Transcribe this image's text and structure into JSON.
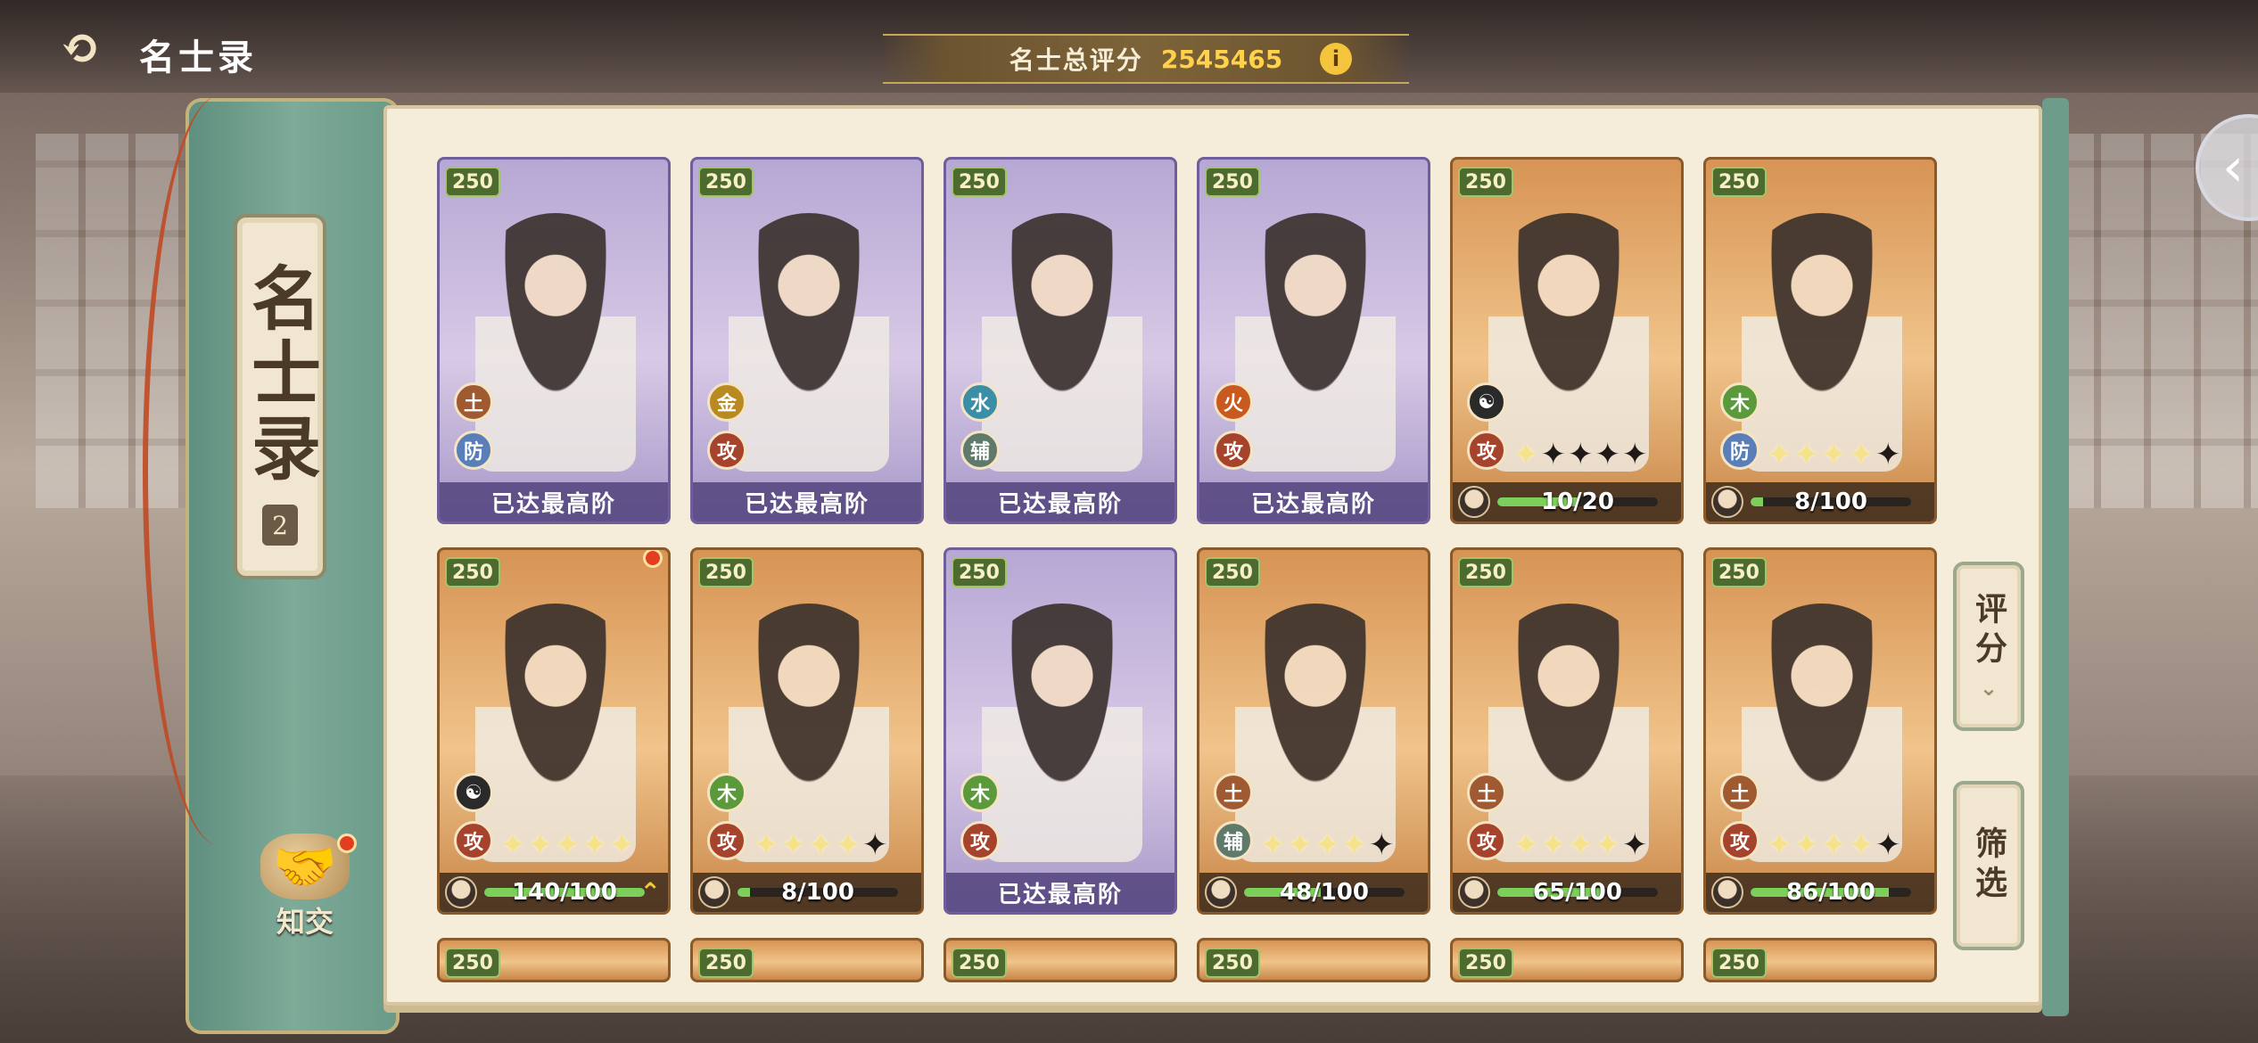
{
  "header": {
    "title": "名士录",
    "score_label": "名士总评分",
    "score_value": "2545465",
    "info_icon": "i"
  },
  "sidebar": {
    "plaque_title": "名士录",
    "plaque_number": "2",
    "friend_label": "知交"
  },
  "buttons": {
    "sort_label": "评分",
    "sort_chevron": "⌄",
    "filter_label": "筛选"
  },
  "colors": {
    "panel_bg": "#f5ecd9",
    "card_purple": "#b6a8d4",
    "card_orange": "#d79454",
    "score_value": "#ffd24a",
    "progress_green": "#7ccf5a",
    "side_green": "#7eaa98"
  },
  "cards": [
    {
      "level": "250",
      "bg": "purple",
      "element": "土",
      "element_class": "e-tu",
      "role": "防",
      "role_class": "fang",
      "maxed": true,
      "maxed_label": "已达最高阶"
    },
    {
      "level": "250",
      "bg": "purple",
      "element": "金",
      "element_class": "e-jin",
      "role": "攻",
      "role_class": "",
      "maxed": true,
      "maxed_label": "已达最高阶"
    },
    {
      "level": "250",
      "bg": "purple",
      "element": "水",
      "element_class": "e-shui",
      "role": "辅",
      "role_class": "fu",
      "maxed": true,
      "maxed_label": "已达最高阶"
    },
    {
      "level": "250",
      "bg": "purple",
      "element": "火",
      "element_class": "e-huo",
      "role": "攻",
      "role_class": "",
      "maxed": true,
      "maxed_label": "已达最高阶"
    },
    {
      "level": "250",
      "bg": "orange",
      "element": "☯",
      "element_class": "e-yy",
      "role": "攻",
      "role_class": "",
      "maxed": false,
      "stars_on": 1,
      "stars_total": 5,
      "progress": "10/20",
      "fraction": 0.5,
      "upgrade": false
    },
    {
      "level": "250",
      "bg": "orange",
      "element": "木",
      "element_class": "e-mu",
      "role": "防",
      "role_class": "fang",
      "maxed": false,
      "stars_on": 4,
      "stars_total": 5,
      "progress": "8/100",
      "fraction": 0.08,
      "upgrade": false
    },
    {
      "level": "250",
      "bg": "orange",
      "element": "☯",
      "element_class": "e-yy",
      "role": "攻",
      "role_class": "",
      "maxed": false,
      "stars_on": 5,
      "stars_total": 5,
      "progress": "140/100",
      "fraction": 1.0,
      "upgrade": true,
      "red_dot": true
    },
    {
      "level": "250",
      "bg": "orange",
      "element": "木",
      "element_class": "e-mu",
      "role": "攻",
      "role_class": "",
      "maxed": false,
      "stars_on": 4,
      "stars_total": 5,
      "progress": "8/100",
      "fraction": 0.08,
      "upgrade": false
    },
    {
      "level": "250",
      "bg": "purple",
      "element": "木",
      "element_class": "e-mu",
      "role": "攻",
      "role_class": "",
      "maxed": true,
      "maxed_label": "已达最高阶"
    },
    {
      "level": "250",
      "bg": "orange",
      "element": "土",
      "element_class": "e-tu",
      "role": "辅",
      "role_class": "fu",
      "maxed": false,
      "stars_on": 4,
      "stars_total": 5,
      "progress": "48/100",
      "fraction": 0.48,
      "upgrade": false
    },
    {
      "level": "250",
      "bg": "orange",
      "element": "土",
      "element_class": "e-tu",
      "role": "攻",
      "role_class": "",
      "maxed": false,
      "stars_on": 4,
      "stars_total": 5,
      "progress": "65/100",
      "fraction": 0.65,
      "upgrade": false
    },
    {
      "level": "250",
      "bg": "orange",
      "element": "土",
      "element_class": "e-tu",
      "role": "攻",
      "role_class": "",
      "maxed": false,
      "stars_on": 4,
      "stars_total": 5,
      "progress": "86/100",
      "fraction": 0.86,
      "upgrade": false
    },
    {
      "level": "250",
      "bg": "orange",
      "partial": true
    },
    {
      "level": "250",
      "bg": "orange",
      "partial": true
    },
    {
      "level": "250",
      "bg": "orange",
      "partial": true
    },
    {
      "level": "250",
      "bg": "orange",
      "partial": true
    },
    {
      "level": "250",
      "bg": "orange",
      "partial": true
    },
    {
      "level": "250",
      "bg": "orange",
      "partial": true
    }
  ]
}
